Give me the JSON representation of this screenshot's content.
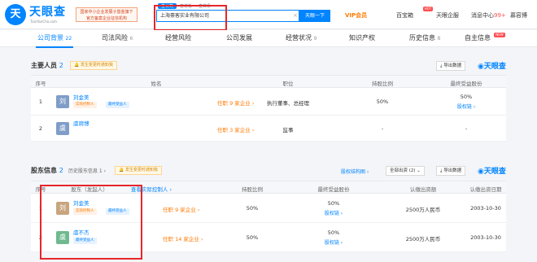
{
  "brand": {
    "name": "天眼查",
    "sub": "TianYanCha.com",
    "ad": "国家中小企业发展子基金旗下\n官方备案企业征信机构"
  },
  "search": {
    "tabs": [
      "查公司",
      "查老板",
      "查关系"
    ],
    "value": "上海豪客实业有限公司",
    "button": "天眼一下",
    "clear": "×"
  },
  "nav": {
    "vip": "VIP会员",
    "baibao": "百宝箱",
    "hot": "HOT",
    "zhidian": "天眼企服",
    "msg": "消息中心",
    "msg_count": "99+",
    "user": "慕容博"
  },
  "tabs": [
    {
      "label": "公司背景",
      "count": "22"
    },
    {
      "label": "司法风险",
      "count": "6"
    },
    {
      "label": "经营风险",
      "count": ""
    },
    {
      "label": "公司发展",
      "count": ""
    },
    {
      "label": "经营状况",
      "count": "9"
    },
    {
      "label": "知识产权",
      "count": ""
    },
    {
      "label": "历史信息",
      "count": "8"
    },
    {
      "label": "自主信息",
      "count": ""
    }
  ],
  "tab_new": "NEW",
  "staff": {
    "title": "主要人员",
    "count": "2",
    "risk": "发生变更时通知我",
    "export": "导出数据",
    "watermark": "天眼查",
    "headers": [
      "序号",
      "姓名",
      "职位",
      "持股比例",
      "最终受益股份"
    ],
    "rows": [
      {
        "no": "1",
        "avatar": "刘",
        "name": "刘金美",
        "tags": [
          "实际控制人",
          "最终受益人"
        ],
        "companies": "任职 9 家企业 ›",
        "position": "执行董事、总经理",
        "ratio": "50%",
        "benefit": "50%",
        "benefit_link": "股权链 ›"
      },
      {
        "no": "2",
        "avatar": "虞",
        "name": "虞骋博",
        "tags": [],
        "companies": "任职 3 家企业 ›",
        "position": "监事",
        "ratio": "-",
        "benefit": "-",
        "benefit_link": ""
      }
    ]
  },
  "holders": {
    "title": "股东信息",
    "count": "2",
    "history": "历史股东信息 1 ›",
    "risk": "发生变更时通知我",
    "structure": "股权结构图 ›",
    "hist_select": "全部出资 (2)",
    "export": "导出数据",
    "watermark": "天眼查",
    "headers": [
      "序号",
      "股东（发起人）",
      "查看实际控制人 ›",
      "持股比例",
      "最终受益股份",
      "认缴出资额",
      "认缴出资日期"
    ],
    "rows": [
      {
        "no": "1",
        "avatar": "刘",
        "name": "刘金美",
        "tags": [
          "实际控制人",
          "最终受益人"
        ],
        "companies": "任职 9 家企业 ›",
        "ratio": "50%",
        "benefit": "50%",
        "benefit_link": "股权链 ›",
        "capital": "2500万人民币",
        "date": "2003-10-30"
      },
      {
        "no": "2",
        "avatar": "虞",
        "name": "虞不杰",
        "tags": [
          "最终受益人"
        ],
        "companies": "任职 14 家企业 ›",
        "ratio": "50%",
        "benefit": "50%",
        "benefit_link": "股权链 ›",
        "capital": "2500万人民币",
        "date": "2003-10-30"
      }
    ]
  }
}
